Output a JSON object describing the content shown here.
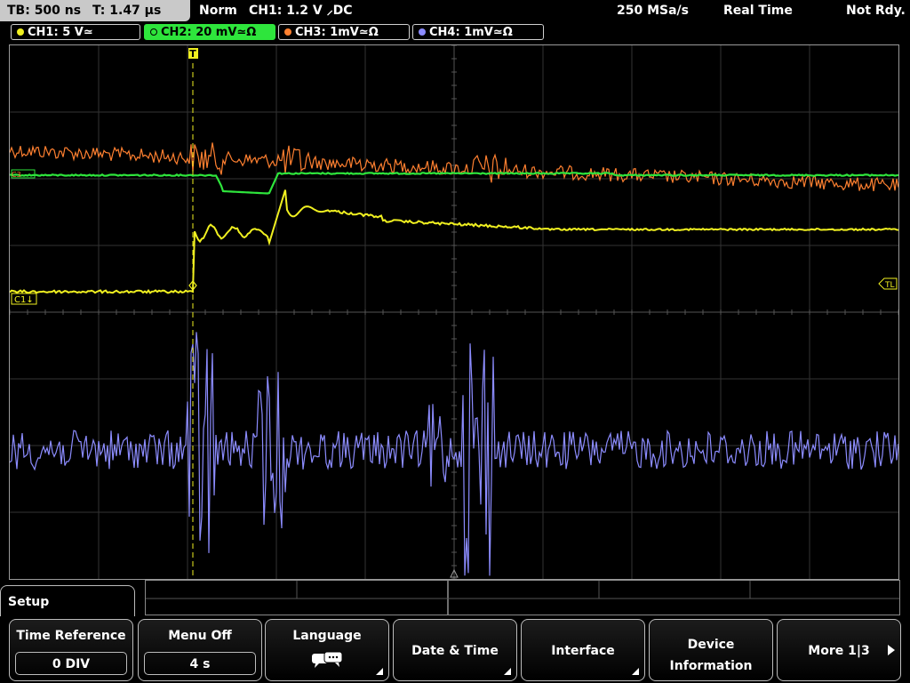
{
  "topbar": {
    "tb": "TB: 500 ns",
    "t": "T: 1.47 µs",
    "mode": "Norm",
    "trigger": "CH1: 1.2 V ⸝DC",
    "sample_rate": "250 MSa/s",
    "acq": "Real Time",
    "status": "Not Rdy."
  },
  "channels": [
    {
      "label": "CH1: 5 V≃",
      "color": "#f0f020"
    },
    {
      "label": "CH2: 20 mV≃Ω",
      "color": "#2ee53c"
    },
    {
      "label": "CH3: 1mV≃Ω",
      "color": "#ff8030"
    },
    {
      "label": "CH4: 1mV≃Ω",
      "color": "#8c8cff"
    }
  ],
  "markers": {
    "trigger": "T",
    "c1": "C1↓",
    "tl": "TL"
  },
  "colors": {
    "ch1": "#f0f020",
    "ch2": "#2ee53c",
    "ch3": "#ff8030",
    "ch4": "#8c8cff",
    "grid": "#3a3a3a"
  },
  "setup_label": "Setup",
  "softkeys": {
    "time_reference": {
      "label": "Time Reference",
      "value": "0 DIV"
    },
    "menu_off": {
      "label": "Menu Off",
      "value": "4 s"
    },
    "language": {
      "label": "Language",
      "icon": "speech-bubbles-icon"
    },
    "date_time": {
      "label": "Date & Time"
    },
    "interface": {
      "label": "Interface"
    },
    "device_information": {
      "line1": "Device",
      "line2": "Information"
    },
    "more": {
      "label": "More 1|3"
    }
  }
}
